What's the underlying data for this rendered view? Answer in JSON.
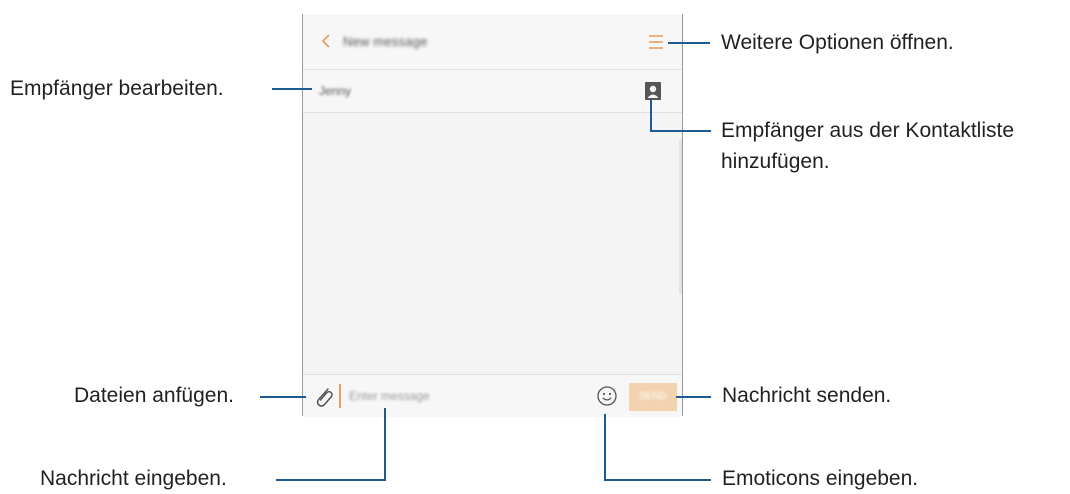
{
  "screen": {
    "header_title": "New message",
    "recipient": "Jenny",
    "compose_placeholder": "Enter message",
    "send_label": "SEND"
  },
  "annotations": {
    "more_options": "Weitere Optionen öffnen.",
    "edit_recipient": "Empfänger bearbeiten.",
    "add_from_contacts_line1": "Empfänger aus der Kontaktliste",
    "add_from_contacts_line2": "hinzufügen.",
    "attach_files": "Dateien anfügen.",
    "send_message": "Nachricht senden.",
    "enter_message": "Nachricht eingeben.",
    "enter_emoticons": "Emoticons eingeben."
  },
  "colors": {
    "accent": "#e8a062",
    "leader_line": "#1d5a93",
    "send_button": "#f3d2b0"
  },
  "icons": [
    "back-arrow-icon",
    "menu-icon",
    "contact-icon",
    "paperclip-icon",
    "smiley-icon"
  ]
}
